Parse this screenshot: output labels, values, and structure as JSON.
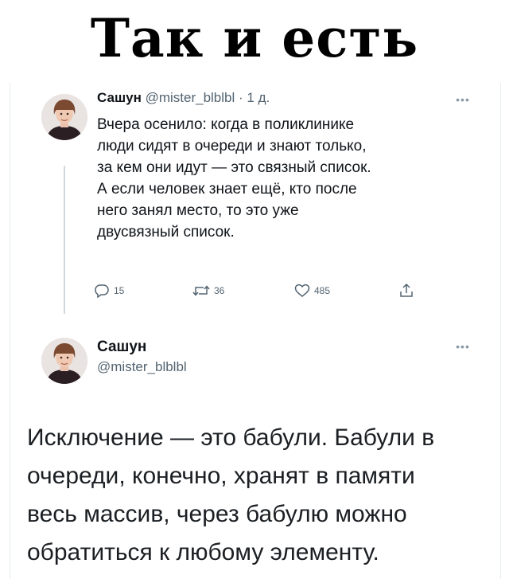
{
  "meme": {
    "title": "Так и есть"
  },
  "thread": {
    "tweet1": {
      "name": "Сашун",
      "handle": "@mister_blblbl",
      "separator": "·",
      "time": "1 д.",
      "more_icon": "•••",
      "lines": [
        "Вчера осенило: когда в поликлинике",
        "люди сидят в очереди и знают только,",
        "за кем они идут — это связный список.",
        "А если человек знает ещё, кто после",
        "него занял место, то это уже",
        "двусвязный список."
      ],
      "actions": {
        "reply_count": "15",
        "retweet_count": "36",
        "like_count": "485",
        "icons": [
          "reply-icon",
          "retweet-icon",
          "like-icon",
          "share-icon"
        ]
      }
    },
    "tweet2": {
      "name": "Сашун",
      "handle": "@mister_blblbl",
      "more_icon": "•••",
      "lines": [
        "Исключение — это бабули. Бабули в",
        "очереди, конечно, хранят в памяти",
        "весь массив, через бабулю можно",
        "обратиться к любому элементу."
      ]
    }
  },
  "colors": {
    "text": "#0f1419",
    "secondary": "#536471",
    "thread_line": "#cfd9de"
  }
}
